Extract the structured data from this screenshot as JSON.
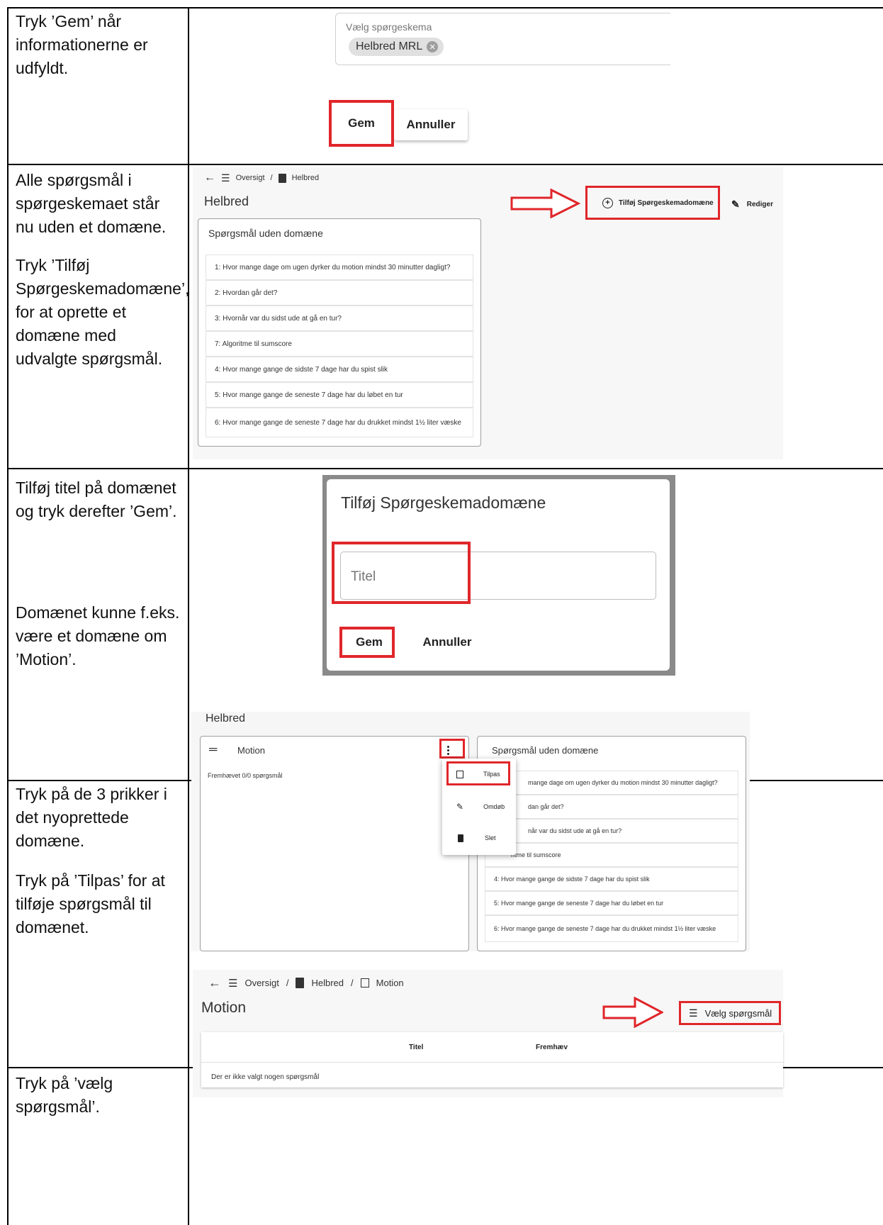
{
  "rows": [
    {
      "text": "Tryk ’Gem’ når informationerne er udfyldt."
    },
    {
      "text": "Alle spørgsmål i spørgeskemaet står nu uden et domæne.",
      "text2": "Tryk ’Tilføj Spørgeskemadomæne’, for at oprette et domæne med udvalgte spørgsmål."
    },
    {
      "text": "Tilføj titel på domænet og tryk derefter ’Gem’.",
      "text2": "Domænet kunne f.eks. være et domæne om ’Motion’."
    },
    {
      "text": "Tryk på de 3 prikker i det nyoprettede domæne.",
      "text2": "Tryk på ’Tilpas’ for at tilføje spørgsmål til domænet."
    },
    {
      "text": "Tryk på ’vælg spørgsmål’."
    }
  ],
  "shot1": {
    "field_label": "Vælg spørgeskema",
    "chip": "Helbred MRL",
    "save": "Gem",
    "cancel": "Annuller"
  },
  "shot2": {
    "crumb1": "Oversigt",
    "sep": "/",
    "crumb2": "Helbred",
    "title": "Helbred",
    "add_domain": "Tilføj Spørgeskemadomæne",
    "edit": "Rediger",
    "card_title": "Spørgsmål uden domæne",
    "questions": [
      "1: Hvor mange dage om ugen dyrker du motion mindst 30 minutter dagligt?",
      "2: Hvordan går det?",
      "3: Hvornår var du sidst ude at gå en tur?",
      "7: Algoritme til sumscore",
      "4: Hvor mange gange de sidste 7 dage har du spist slik",
      "5: Hvor mange gange de seneste 7 dage har du løbet en tur",
      "6: Hvor mange gange de seneste 7 dage har du drukket mindst 1½ liter væske"
    ]
  },
  "shot3": {
    "title": "Tilføj Spørgeskemadomæne",
    "placeholder": "Titel",
    "save": "Gem",
    "cancel": "Annuller"
  },
  "shot4": {
    "page_title": "Helbred",
    "domain_name": "Motion",
    "highlight": "Fremhævet 0/0 spørgsmål",
    "right_title": "Spørgsmål uden domæne",
    "menu": [
      "Tilpas",
      "Omdøb",
      "Slet"
    ],
    "questions_partial": [
      "mange dage om ugen dyrker du motion mindst 30 minutter dagligt?",
      "dan går det?",
      "når var du sidst ude at gå en tur?",
      "ritme til sumscore",
      "4: Hvor mange gange de sidste 7 dage har du spist slik",
      "5: Hvor mange gange de seneste 7 dage har du løbet en tur",
      "6: Hvor mange gange de seneste 7 dage har du drukket mindst 1½ liter væske"
    ]
  },
  "shot5": {
    "crumb1": "Oversigt",
    "sep": "/",
    "crumb2": "Helbred",
    "crumb3": "Motion",
    "title": "Motion",
    "choose": "Vælg spørgsmål",
    "col1": "Titel",
    "col2": "Fremhæv",
    "empty": "Der er ikke valgt nogen spørgsmål"
  },
  "colors": {
    "accent_red": "#e0262a",
    "text": "#222222",
    "chip_bg": "#e0e0e0"
  },
  "icons": [
    "arrow-left-icon",
    "list-icon",
    "document-icon",
    "plus-circle-icon",
    "pencil-icon",
    "drag-handle-icon",
    "more-vert-icon",
    "checklist-icon",
    "trash-icon",
    "close-circle-icon",
    "red-arrow-icon"
  ]
}
